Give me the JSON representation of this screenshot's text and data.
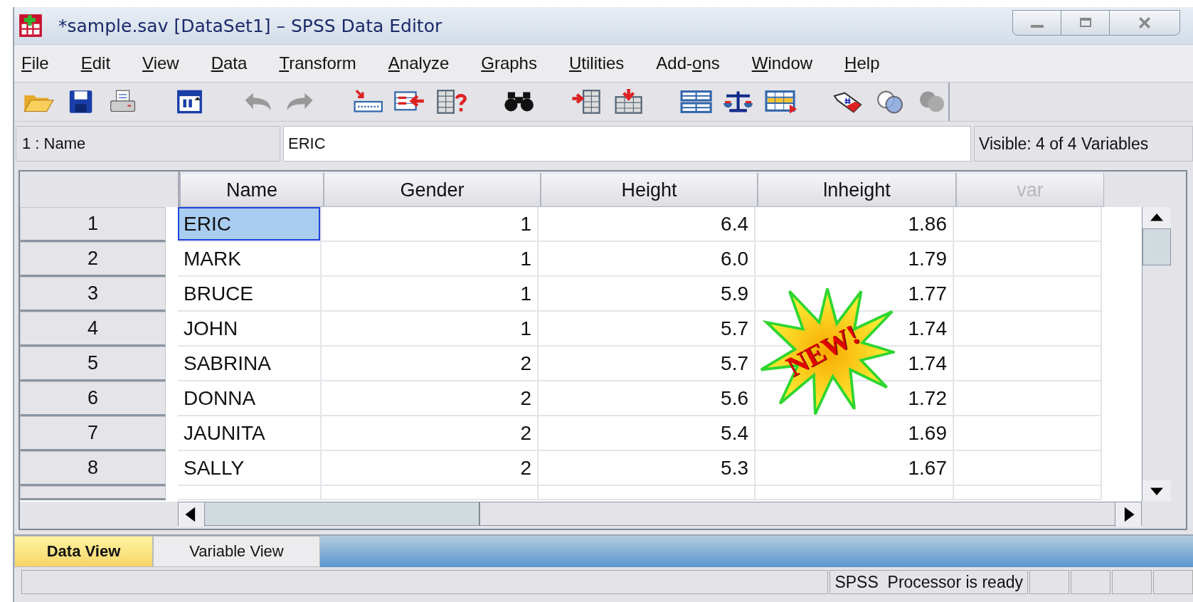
{
  "window": {
    "title": "*sample.sav [DataSet1] – SPSS Data Editor"
  },
  "menu": [
    {
      "key": "F",
      "post": "ile"
    },
    {
      "key": "E",
      "post": "dit"
    },
    {
      "key": "V",
      "post": "iew"
    },
    {
      "key": "D",
      "post": "ata"
    },
    {
      "key": "T",
      "post": "ransform"
    },
    {
      "key": "A",
      "post": "nalyze"
    },
    {
      "key": "G",
      "post": "raphs"
    },
    {
      "key": "U",
      "post": "tilities"
    },
    {
      "pre": "Add-",
      "key": "o",
      "post": "ns"
    },
    {
      "key": "W",
      "post": "indow"
    },
    {
      "key": "H",
      "post": "elp"
    }
  ],
  "cell_editor": {
    "cell": "1 : Name",
    "value": "ERIC",
    "visible": "Visible: 4 of 4 Variables"
  },
  "table": {
    "columns": [
      {
        "label": "Name",
        "kind": "text"
      },
      {
        "label": "Gender",
        "kind": "number"
      },
      {
        "label": "Height",
        "kind": "number"
      },
      {
        "label": "lnheight",
        "kind": "number"
      },
      {
        "label": "var",
        "kind": "empty"
      }
    ],
    "rows": [
      {
        "number": "1",
        "cells": [
          "ERIC",
          "1",
          "6.4",
          "1.86"
        ],
        "selected": true
      },
      {
        "number": "2",
        "cells": [
          "MARK",
          "1",
          "6.0",
          "1.79"
        ],
        "selected": false
      },
      {
        "number": "3",
        "cells": [
          "BRUCE",
          "1",
          "5.9",
          "1.77"
        ],
        "selected": false
      },
      {
        "number": "4",
        "cells": [
          "JOHN",
          "1",
          "5.7",
          "1.74"
        ],
        "selected": false
      },
      {
        "number": "5",
        "cells": [
          "SABRINA",
          "2",
          "5.7",
          "1.74"
        ],
        "selected": false
      },
      {
        "number": "6",
        "cells": [
          "DONNA",
          "2",
          "5.6",
          "1.72"
        ],
        "selected": false
      },
      {
        "number": "7",
        "cells": [
          "JAUNITA",
          "2",
          "5.4",
          "1.69"
        ],
        "selected": false
      },
      {
        "number": "8",
        "cells": [
          "SALLY",
          "2",
          "5.3",
          "1.67"
        ],
        "selected": false
      }
    ]
  },
  "badge": {
    "text": "NEW!"
  },
  "tabs": [
    {
      "label": "Data View",
      "selected": true
    },
    {
      "label": "Variable View",
      "selected": false
    }
  ],
  "status_bar": {
    "message": "SPSS  Processor is ready"
  }
}
